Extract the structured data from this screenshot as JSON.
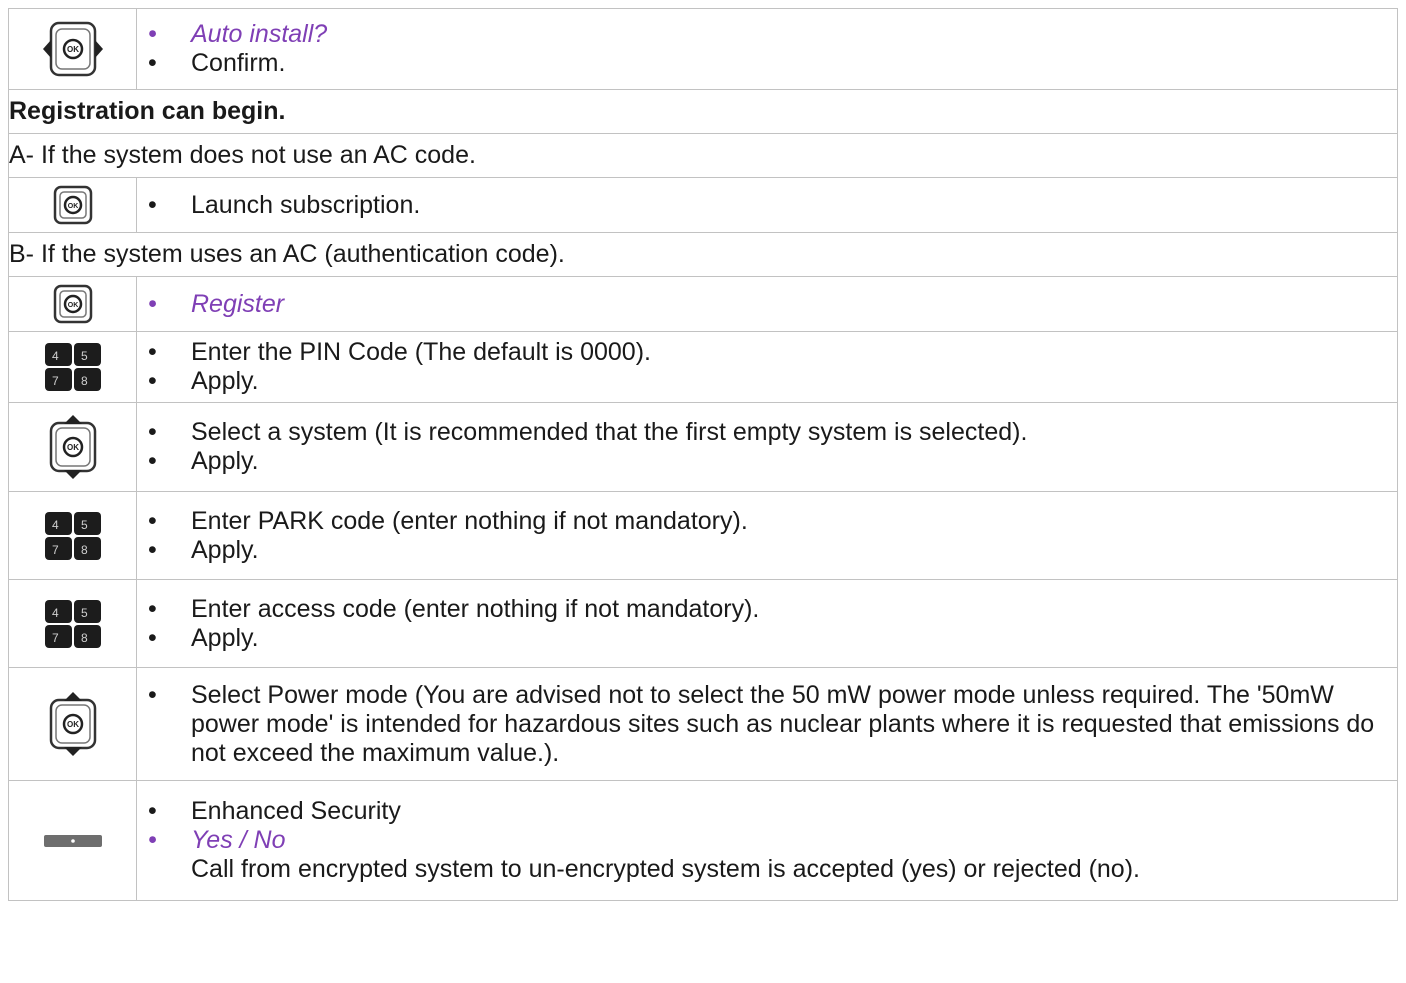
{
  "icons": {
    "ok_left_right": "ok-key-with-left-right-arrows-icon",
    "ok_button": "ok-key-icon",
    "ok_up_down": "ok-key-with-up-down-arrows-icon",
    "keypad": "numeric-keypad-icon",
    "side_key": "side-key-icon",
    "ok_glyph": "OK",
    "keypad_keys": [
      "4",
      "5",
      "7",
      "8"
    ]
  },
  "colors": {
    "italic_text": "#7f3fb5",
    "border": "#c2c2c2"
  },
  "rows": {
    "r1": {
      "items": [
        "Auto install?",
        "Confirm."
      ]
    },
    "heading": "Registration can begin.",
    "section_a": "A- If the system does not use an AC code.",
    "r_a1": {
      "items": [
        "Launch subscription."
      ]
    },
    "section_b": "B- If the system uses an AC (authentication code).",
    "r_b1": {
      "items": [
        "Register"
      ]
    },
    "r_b2": {
      "items": [
        "Enter the PIN Code (The default is 0000).",
        "Apply."
      ]
    },
    "r_b3": {
      "items": [
        "Select a system (It is recommended that the first empty system is selected).",
        "Apply."
      ]
    },
    "r_b4": {
      "items": [
        "Enter PARK code (enter nothing if not mandatory).",
        "Apply."
      ]
    },
    "r_b5": {
      "items": [
        "Enter access code (enter nothing if not mandatory).",
        "Apply."
      ]
    },
    "r_b6": {
      "items": [
        "Select Power mode (You are advised not to select the 50 mW power mode unless required. The '50mW power mode' is intended for hazardous sites such as nuclear plants where it is requested that emissions do not exceed the maximum value.)."
      ]
    },
    "r_b7": {
      "items": [
        "Enhanced Security",
        "Yes / No"
      ],
      "note": "Call from encrypted system to un-encrypted system is accepted (yes) or rejected (no)."
    }
  }
}
